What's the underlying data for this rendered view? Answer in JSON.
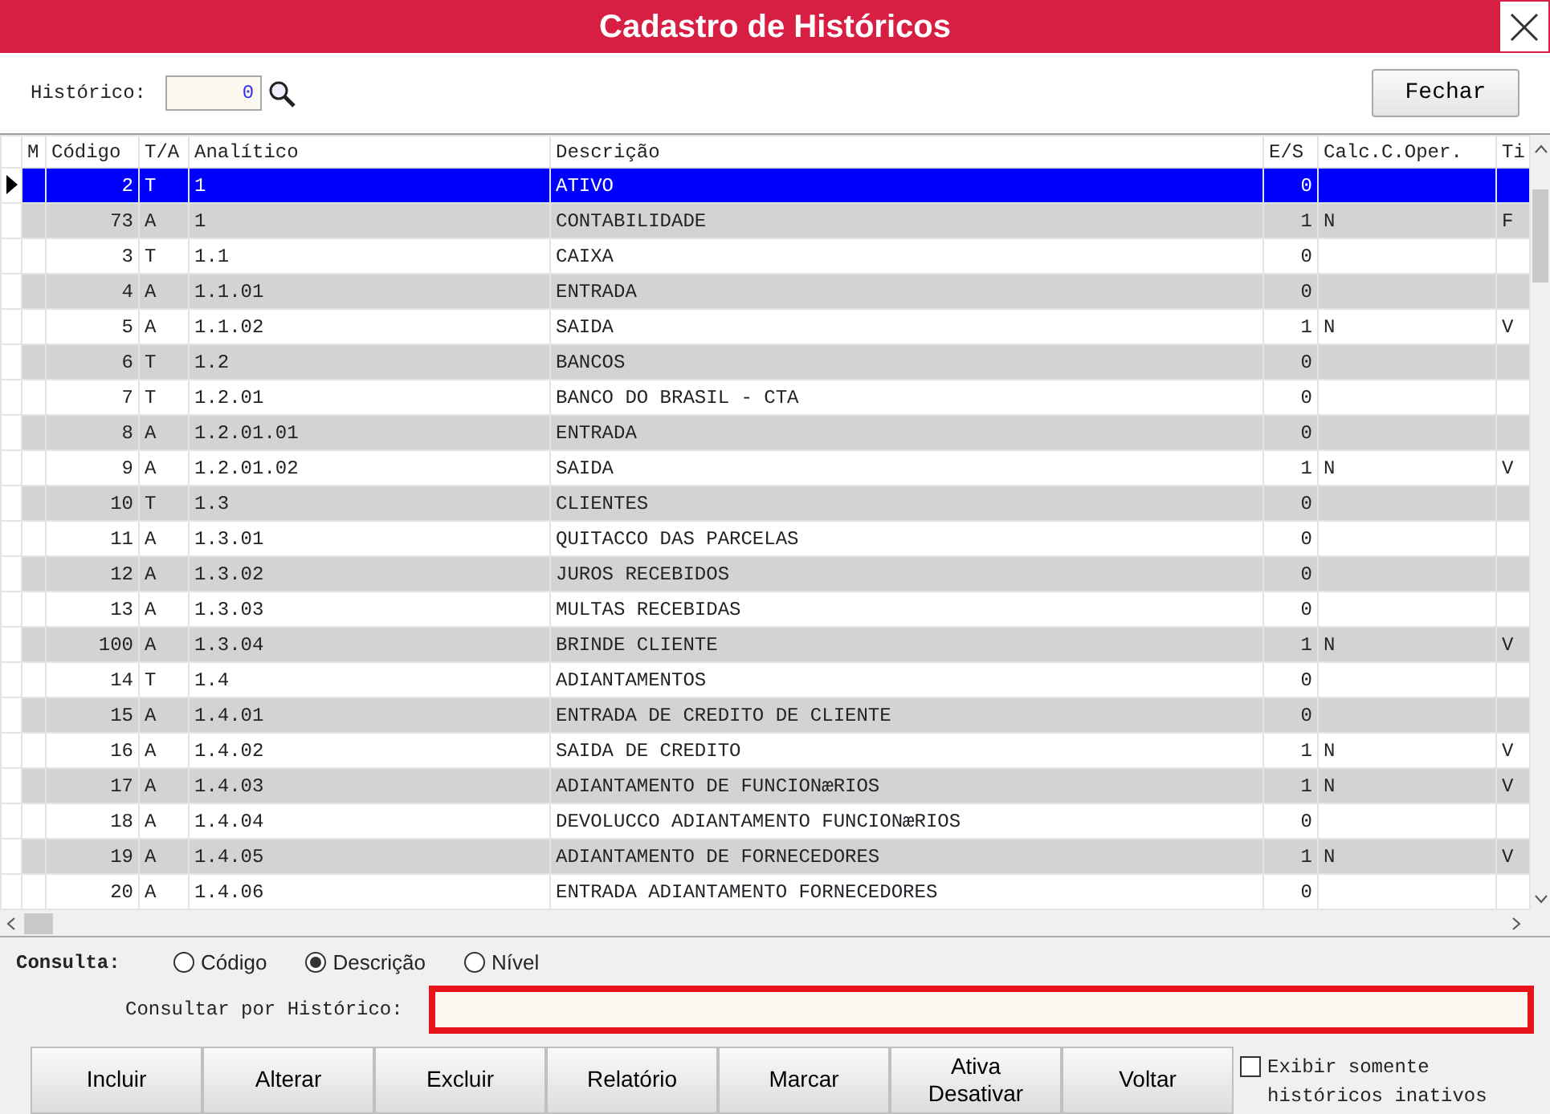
{
  "window": {
    "title": "Cadastro de Históricos"
  },
  "toolbar": {
    "label": "Histórico:",
    "value": "0",
    "button": "Fechar"
  },
  "table": {
    "columns": [
      "M",
      "Código",
      "T/A",
      "Analítico",
      "Descrição",
      "E/S",
      "Calc.C.Oper.",
      "Ti"
    ],
    "rows": [
      {
        "selected": true,
        "cells": [
          "",
          "2",
          "T",
          "1",
          "ATIVO",
          "0",
          "",
          ""
        ]
      },
      {
        "selected": false,
        "cells": [
          "",
          "73",
          "A",
          "1",
          "CONTABILIDADE",
          "1",
          "N",
          "F"
        ]
      },
      {
        "selected": false,
        "cells": [
          "",
          "3",
          "T",
          "1.1",
          "CAIXA",
          "0",
          "",
          ""
        ]
      },
      {
        "selected": false,
        "cells": [
          "",
          "4",
          "A",
          "1.1.01",
          "ENTRADA",
          "0",
          "",
          ""
        ]
      },
      {
        "selected": false,
        "cells": [
          "",
          "5",
          "A",
          "1.1.02",
          "SAIDA",
          "1",
          "N",
          "V"
        ]
      },
      {
        "selected": false,
        "cells": [
          "",
          "6",
          "T",
          "1.2",
          "BANCOS",
          "0",
          "",
          ""
        ]
      },
      {
        "selected": false,
        "cells": [
          "",
          "7",
          "T",
          "1.2.01",
          "BANCO DO BRASIL - CTA",
          "0",
          "",
          ""
        ]
      },
      {
        "selected": false,
        "cells": [
          "",
          "8",
          "A",
          "1.2.01.01",
          "ENTRADA",
          "0",
          "",
          ""
        ]
      },
      {
        "selected": false,
        "cells": [
          "",
          "9",
          "A",
          "1.2.01.02",
          "SAIDA",
          "1",
          "N",
          "V"
        ]
      },
      {
        "selected": false,
        "cells": [
          "",
          "10",
          "T",
          "1.3",
          "CLIENTES",
          "0",
          "",
          ""
        ]
      },
      {
        "selected": false,
        "cells": [
          "",
          "11",
          "A",
          "1.3.01",
          "QUITACCO DAS PARCELAS",
          "0",
          "",
          ""
        ]
      },
      {
        "selected": false,
        "cells": [
          "",
          "12",
          "A",
          "1.3.02",
          "JUROS RECEBIDOS",
          "0",
          "",
          ""
        ]
      },
      {
        "selected": false,
        "cells": [
          "",
          "13",
          "A",
          "1.3.03",
          "MULTAS RECEBIDAS",
          "0",
          "",
          ""
        ]
      },
      {
        "selected": false,
        "cells": [
          "",
          "100",
          "A",
          "1.3.04",
          "BRINDE CLIENTE",
          "1",
          "N",
          "V"
        ]
      },
      {
        "selected": false,
        "cells": [
          "",
          "14",
          "T",
          "1.4",
          "ADIANTAMENTOS",
          "0",
          "",
          ""
        ]
      },
      {
        "selected": false,
        "cells": [
          "",
          "15",
          "A",
          "1.4.01",
          "ENTRADA DE CREDITO DE CLIENTE",
          "0",
          "",
          ""
        ]
      },
      {
        "selected": false,
        "cells": [
          "",
          "16",
          "A",
          "1.4.02",
          "SAIDA DE CREDITO",
          "1",
          "N",
          "V"
        ]
      },
      {
        "selected": false,
        "cells": [
          "",
          "17",
          "A",
          "1.4.03",
          "ADIANTAMENTO DE FUNCIONæRIOS",
          "1",
          "N",
          "V"
        ]
      },
      {
        "selected": false,
        "cells": [
          "",
          "18",
          "A",
          "1.4.04",
          "DEVOLUCCO ADIANTAMENTO FUNCIONæRIOS",
          "0",
          "",
          ""
        ]
      },
      {
        "selected": false,
        "cells": [
          "",
          "19",
          "A",
          "1.4.05",
          "ADIANTAMENTO DE FORNECEDORES",
          "1",
          "N",
          "V"
        ]
      },
      {
        "selected": false,
        "cells": [
          "",
          "20",
          "A",
          "1.4.06",
          "ENTRADA ADIANTAMENTO FORNECEDORES",
          "0",
          "",
          ""
        ]
      }
    ]
  },
  "search": {
    "label": "Consulta:",
    "options": [
      {
        "label": "Código",
        "selected": false
      },
      {
        "label": "Descrição",
        "selected": true
      },
      {
        "label": "Nível",
        "selected": false
      }
    ],
    "field_label": "Consultar por Histórico:",
    "highlighted": true
  },
  "buttons": [
    [
      "Incluir"
    ],
    [
      "Alterar"
    ],
    [
      "Excluir"
    ],
    [
      "Relatório"
    ],
    [
      "Marcar"
    ],
    [
      "Ativa",
      "Desativar"
    ],
    [
      "Voltar"
    ]
  ],
  "filter": {
    "label": "Exibir somente históricos inativos",
    "checked": false
  }
}
